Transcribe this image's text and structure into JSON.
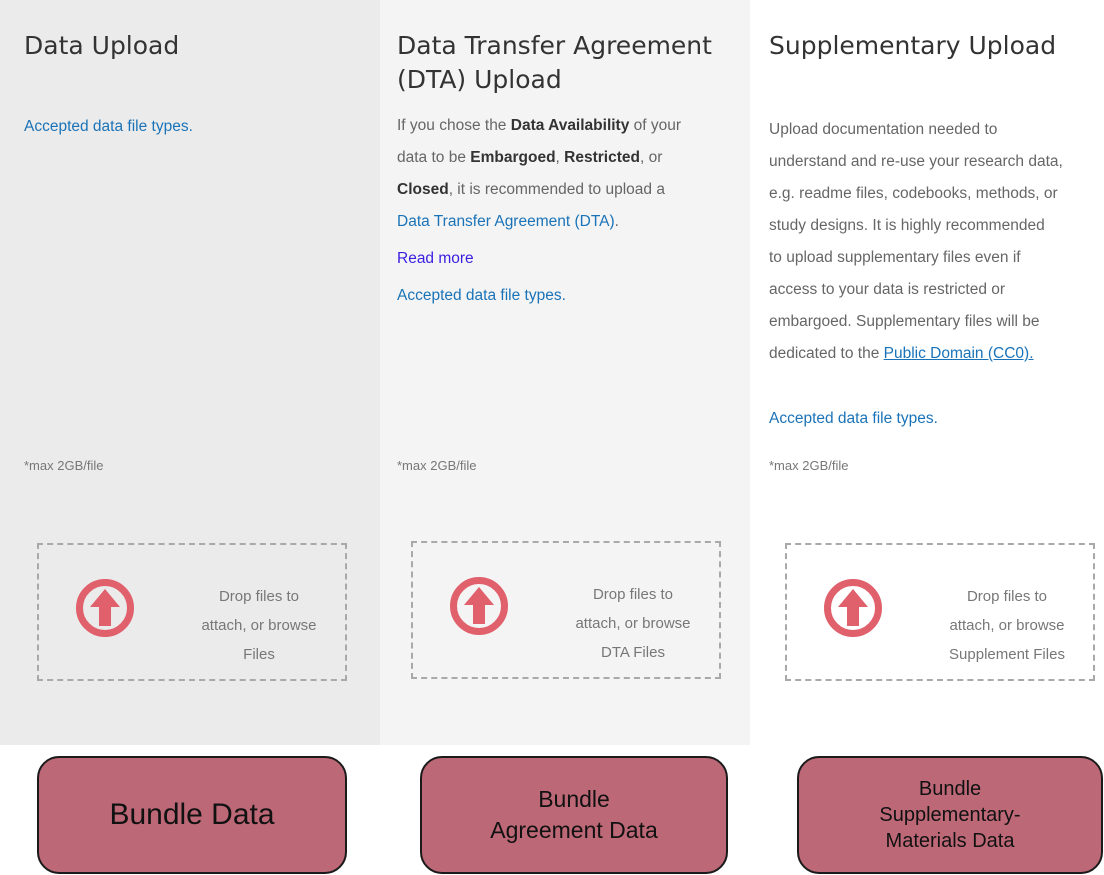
{
  "panels": {
    "data": {
      "title": "Data Upload",
      "accepted_link": "Accepted data file types.",
      "max_note": "*max 2GB/file",
      "drop_text": [
        "Drop files to",
        "attach, or browse",
        "Files"
      ]
    },
    "dta": {
      "title_line1": "Data Transfer Agreement",
      "title_line2": "(DTA) Upload",
      "desc": {
        "l1_a": "If you chose the ",
        "l1_b": "Data Availability",
        "l1_c": " of your",
        "l2_a": "data to be ",
        "l2_b": "Embargoed",
        "l2_c": ", ",
        "l2_d": "Restricted",
        "l2_e": ", or",
        "l3_a": "Closed",
        "l3_b": ", it is recommended to upload a",
        "l4_link": "Data Transfer Agreement (DTA)",
        "l4_end": "."
      },
      "read_more": "Read more",
      "accepted_link": "Accepted data file types.",
      "max_note": "*max 2GB/file",
      "drop_text": [
        "Drop files to",
        "attach, or browse",
        "DTA Files"
      ]
    },
    "supp": {
      "title": "Supplementary Upload",
      "desc_lines": [
        "Upload documentation needed to",
        "understand and re-use your research data,",
        "e.g. readme files, codebooks, methods, or",
        "study designs. It is highly recommended",
        "to upload supplementary files even if",
        "access to your data is restricted or",
        "embargoed. Supplementary files will be"
      ],
      "desc_last_prefix": "dedicated to the ",
      "desc_last_link": "Public Domain (CC0).",
      "accepted_link": "Accepted data file types.",
      "max_note": "*max 2GB/file",
      "drop_text": [
        "Drop files to",
        "attach, or browse",
        "Supplement Files"
      ]
    }
  },
  "icons": {
    "upload": "upload-arrow-circle-icon"
  },
  "colors": {
    "upload_icon": "#e0606c",
    "link": "#1a73b8",
    "read_more": "#3a1ee0",
    "button_fill": "#bd6877"
  },
  "buttons": {
    "bundle_data": [
      "Bundle Data"
    ],
    "bundle_agreement": [
      "Bundle",
      "Agreement Data"
    ],
    "bundle_supp": [
      "Bundle",
      "Supplementary-",
      "Materials Data"
    ]
  }
}
